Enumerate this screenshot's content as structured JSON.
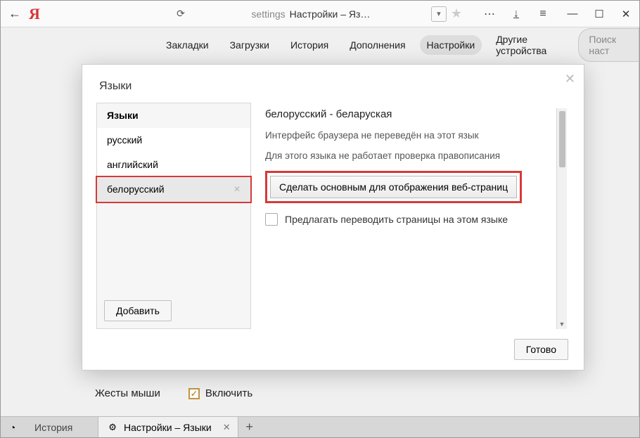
{
  "titlebar": {
    "addr_prefix": "settings",
    "addr_title": "Настройки – Яз…"
  },
  "nav": {
    "items": [
      "Закладки",
      "Загрузки",
      "История",
      "Дополнения",
      "Настройки",
      "Другие устройства"
    ],
    "active_index": 4,
    "search_placeholder": "Поиск наст"
  },
  "dialog": {
    "title": "Языки",
    "list_header": "Языки",
    "languages": [
      "русский",
      "английский",
      "белорусский"
    ],
    "selected_index": 2,
    "add_label": "Добавить",
    "done_label": "Готово"
  },
  "details": {
    "heading": "белорусский - беларуская",
    "line1": "Интерфейс браузера не переведён на этот язык",
    "line2": "Для этого языка не работает проверка правописания",
    "main_button": "Сделать основным для отображения веб-страниц",
    "offer_translate": "Предлагать переводить страницы на этом языке"
  },
  "below": {
    "section": "Жесты мыши",
    "check_label": "Включить"
  },
  "tabs": {
    "tab1": "История",
    "tab2": "Настройки – Языки"
  }
}
